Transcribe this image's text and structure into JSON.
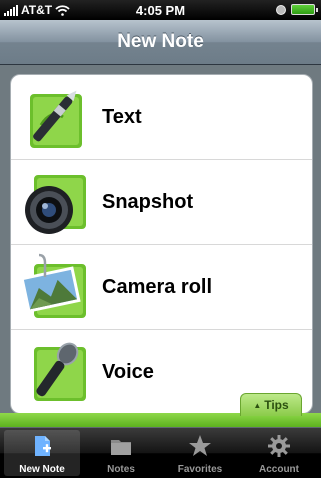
{
  "status_bar": {
    "carrier": "AT&T",
    "time": "4:05 PM"
  },
  "nav": {
    "title": "New Note"
  },
  "options": [
    {
      "label": "Text",
      "icon": "pen-icon"
    },
    {
      "label": "Snapshot",
      "icon": "camera-icon"
    },
    {
      "label": "Camera roll",
      "icon": "photo-icon"
    },
    {
      "label": "Voice",
      "icon": "microphone-icon"
    }
  ],
  "tips": {
    "label": "Tips"
  },
  "tabbar": {
    "tabs": [
      {
        "label": "New Note",
        "icon": "new-note-icon",
        "active": true
      },
      {
        "label": "Notes",
        "icon": "folder-icon",
        "active": false
      },
      {
        "label": "Favorites",
        "icon": "star-icon",
        "active": false
      },
      {
        "label": "Account",
        "icon": "gear-icon",
        "active": false
      }
    ]
  },
  "colors": {
    "accent_green": "#7ccb34",
    "nav_blue_gray": "#7d8c99"
  }
}
